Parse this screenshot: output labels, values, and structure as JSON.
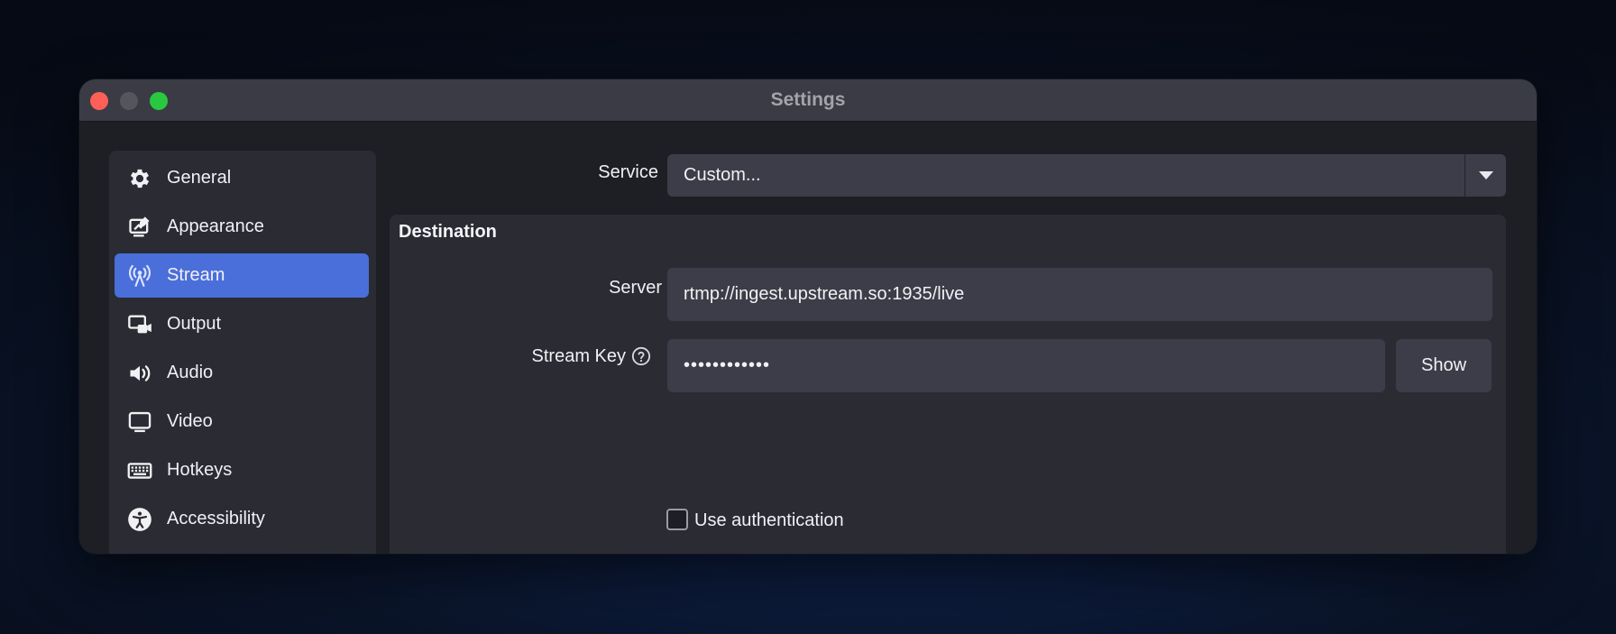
{
  "window": {
    "title": "Settings"
  },
  "sidebar": {
    "items": [
      {
        "label": "General",
        "icon": "gear-icon",
        "active": false
      },
      {
        "label": "Appearance",
        "icon": "appearance-icon",
        "active": false
      },
      {
        "label": "Stream",
        "icon": "antenna-icon",
        "active": true
      },
      {
        "label": "Output",
        "icon": "output-icon",
        "active": false
      },
      {
        "label": "Audio",
        "icon": "speaker-icon",
        "active": false
      },
      {
        "label": "Video",
        "icon": "monitor-icon",
        "active": false
      },
      {
        "label": "Hotkeys",
        "icon": "keyboard-icon",
        "active": false
      },
      {
        "label": "Accessibility",
        "icon": "accessibility-icon",
        "active": false
      }
    ]
  },
  "service": {
    "label": "Service",
    "value": "Custom..."
  },
  "destination": {
    "title": "Destination",
    "server_label": "Server",
    "server_value": "rtmp://ingest.upstream.so:1935/live",
    "stream_key_label": "Stream Key",
    "stream_key_value": "••••••••••••",
    "show_label": "Show",
    "auth_label": "Use authentication",
    "auth_checked": false
  },
  "colors": {
    "accent": "#4a6fdb",
    "window_bg": "#1e1f25",
    "panel_bg": "#2a2b33",
    "field_bg": "#3c3d48"
  }
}
